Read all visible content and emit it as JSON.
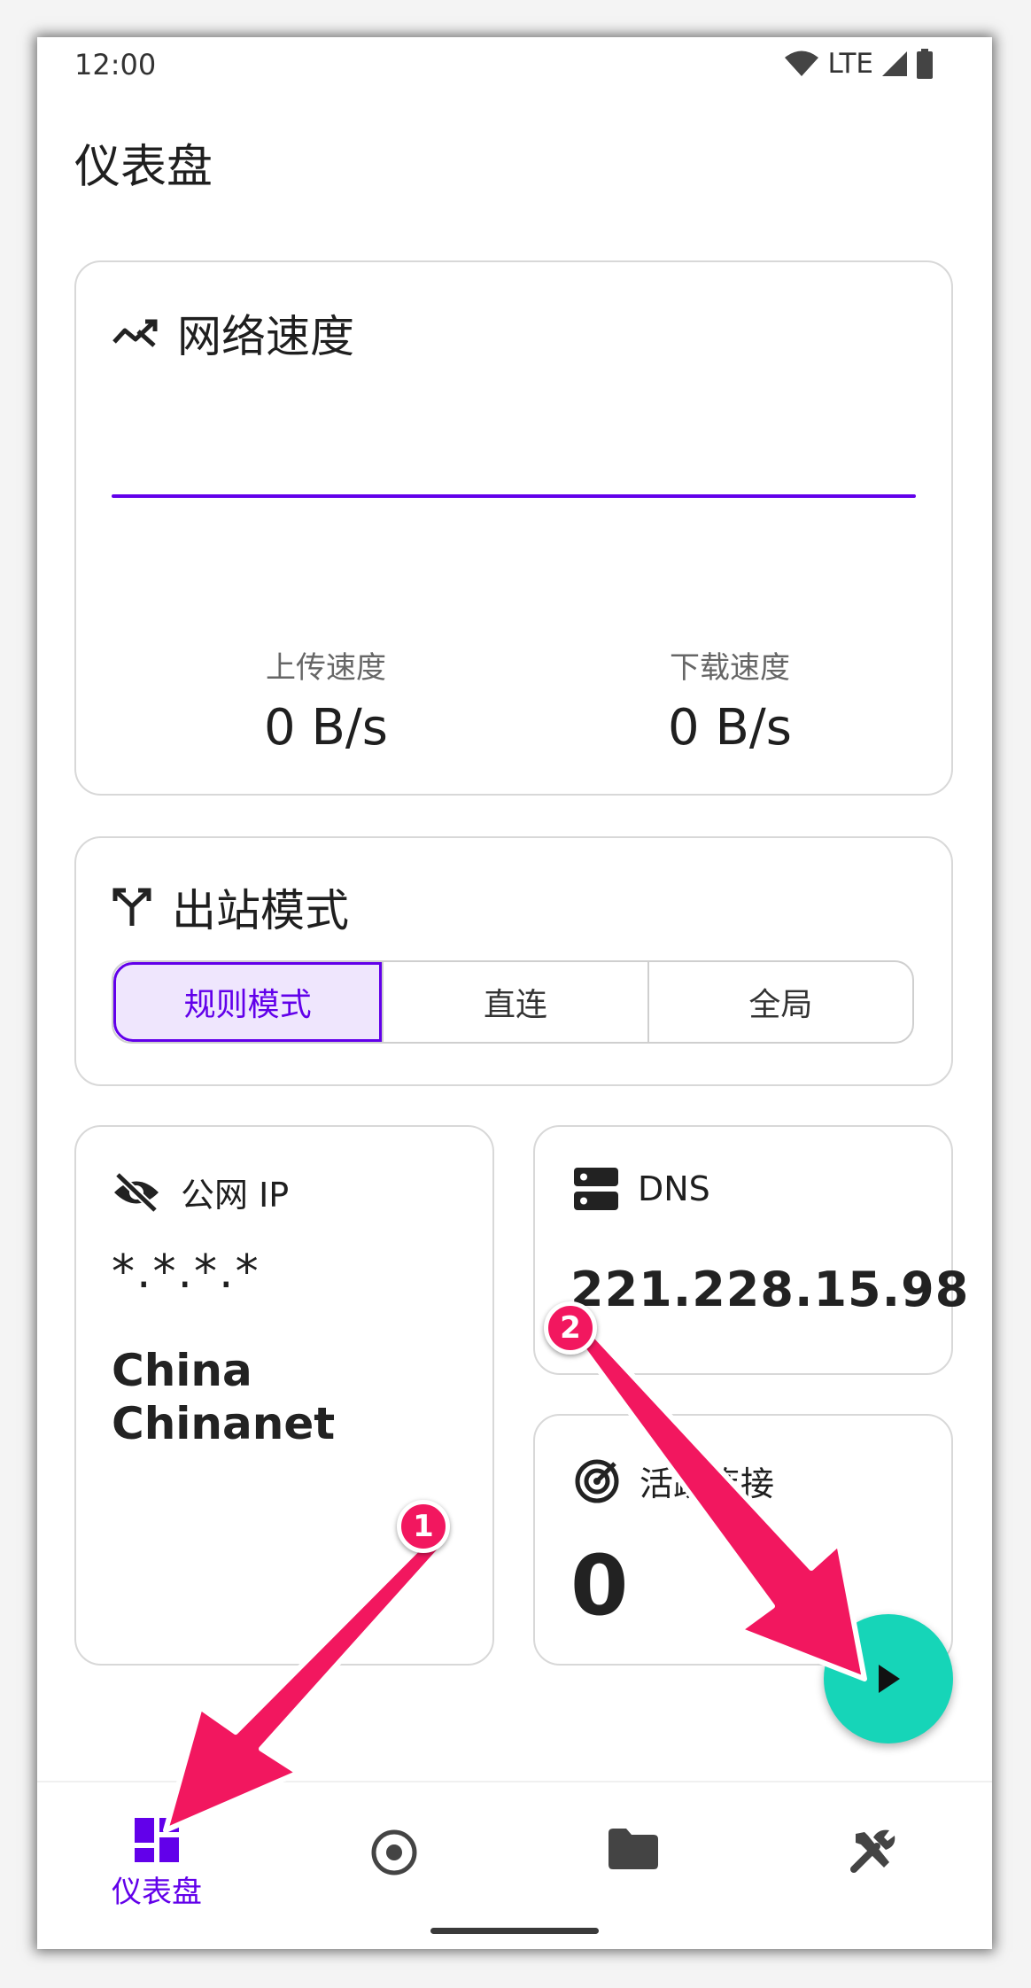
{
  "status_bar": {
    "time": "12:00",
    "network": "LTE",
    "icons": [
      "wifi-icon",
      "signal-icon",
      "battery-icon"
    ]
  },
  "page": {
    "title": "仪表盘"
  },
  "speed_card": {
    "icon": "trend-icon",
    "title": "网络速度",
    "upload_label": "上传速度",
    "upload_value": "0 B/s",
    "download_label": "下载速度",
    "download_value": "0 B/s"
  },
  "mode_card": {
    "icon": "route-split-icon",
    "title": "出站模式",
    "modes": [
      {
        "label": "规则模式",
        "selected": true
      },
      {
        "label": "直连",
        "selected": false
      },
      {
        "label": "全局",
        "selected": false
      }
    ]
  },
  "ip_card": {
    "icon": "eye-off-icon",
    "title": "公网 IP",
    "masked_ip": "*.*.*.*",
    "location_line1": "China",
    "location_line2": "Chinanet"
  },
  "dns_card": {
    "icon": "dns-server-icon",
    "title": "DNS",
    "value": "221.228.15.98"
  },
  "connections_card": {
    "icon": "radar-icon",
    "title": "活跃连接",
    "value": "0"
  },
  "fab": {
    "icon": "play-icon"
  },
  "bottom_nav": [
    {
      "icon": "dashboard-icon",
      "label": "仪表盘",
      "active": true
    },
    {
      "icon": "radio-target-icon",
      "active": false
    },
    {
      "icon": "folder-icon",
      "active": false
    },
    {
      "icon": "tools-icon",
      "active": false
    }
  ],
  "annotations": {
    "marker1": "1",
    "marker2": "2"
  },
  "colors": {
    "accent": "#6200ea",
    "fab": "#16d5b8",
    "arrow": "#f2175f"
  }
}
